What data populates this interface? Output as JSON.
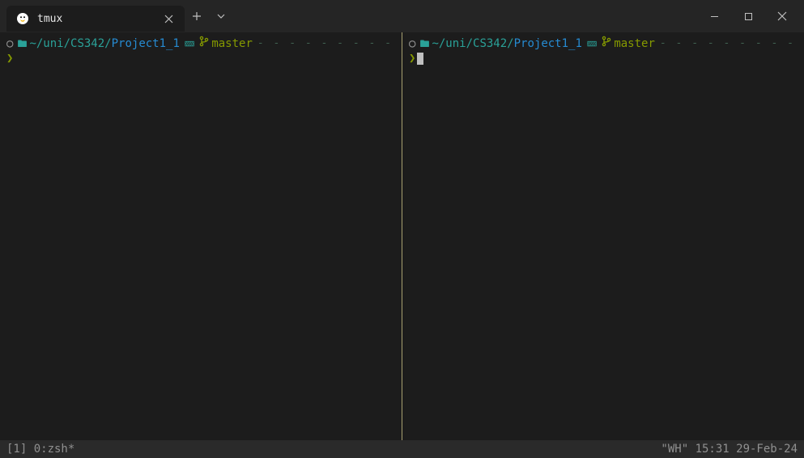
{
  "tab": {
    "title": "tmux"
  },
  "pane_left": {
    "path_prefix": "~/uni/CS342/",
    "path_project": "Project1_1",
    "branch": "master"
  },
  "pane_right": {
    "path_prefix": "~/uni/CS342/",
    "path_project": "Project1_1",
    "branch": "master"
  },
  "status": {
    "left": "[1] 0:zsh*",
    "right": "\"WH\" 15:31 29-Feb-24"
  },
  "dashes": "- - - - - - - - - - - - - - - - - - - - - - - - - - - - - - - - - -"
}
